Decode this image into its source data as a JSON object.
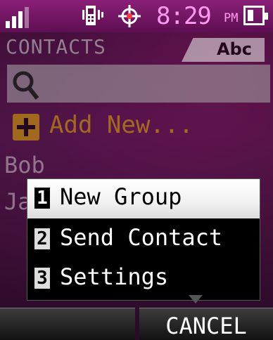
{
  "status": {
    "time": "8:29",
    "ampm": "PM",
    "signal_icon": "signal-bars-icon",
    "vibrate_icon": "vibrate-icon",
    "gps_icon": "gps-icon",
    "battery_icon": "battery-icon"
  },
  "header": {
    "title": "CONTACTS",
    "tab": "Abc"
  },
  "search": {
    "icon": "search-icon"
  },
  "add_new": {
    "label": "Add New..."
  },
  "contacts": [
    {
      "name": "Bob"
    },
    {
      "name": "Ja"
    }
  ],
  "menu": {
    "items": [
      {
        "num": "1",
        "label": "New Group"
      },
      {
        "num": "2",
        "label": "Send Contact"
      },
      {
        "num": "3",
        "label": "Settings"
      }
    ],
    "selected_index": 0
  },
  "softkeys": {
    "left": "",
    "right": "CANCEL"
  },
  "colors": {
    "accent": "#8a1f78",
    "time": "#ff9af0",
    "add_new": "#e3b000"
  }
}
